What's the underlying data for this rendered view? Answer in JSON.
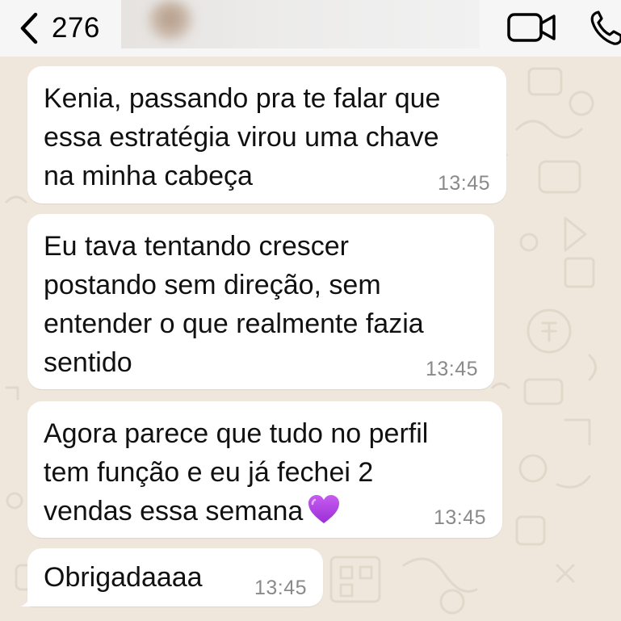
{
  "header": {
    "back_count": "276",
    "contact_name": ""
  },
  "messages": [
    {
      "text": "Kenia, passando pra te falar que\nessa estratégia virou uma chave\nna minha cabeça",
      "time": "13:45"
    },
    {
      "text": "Eu tava tentando crescer\npostando sem direção, sem\nentender o que realmente fazia\nsentido",
      "time": "13:45"
    },
    {
      "text": "Agora parece que tudo no perfil\ntem função e eu já fechei 2\nvendas essa semana",
      "emoji": "purple-heart",
      "time": "13:45"
    },
    {
      "text": "Obrigadaaaa",
      "time": "13:45"
    }
  ],
  "colors": {
    "header_bg": "#f6f6f6",
    "chat_bg": "#efe7dc",
    "bubble_bg": "#ffffff",
    "time_text": "#8a8a8a",
    "heart": "#b44be1"
  },
  "icons": {
    "back": "chevron-left-icon",
    "video": "video-camera-icon",
    "phone": "phone-icon"
  }
}
